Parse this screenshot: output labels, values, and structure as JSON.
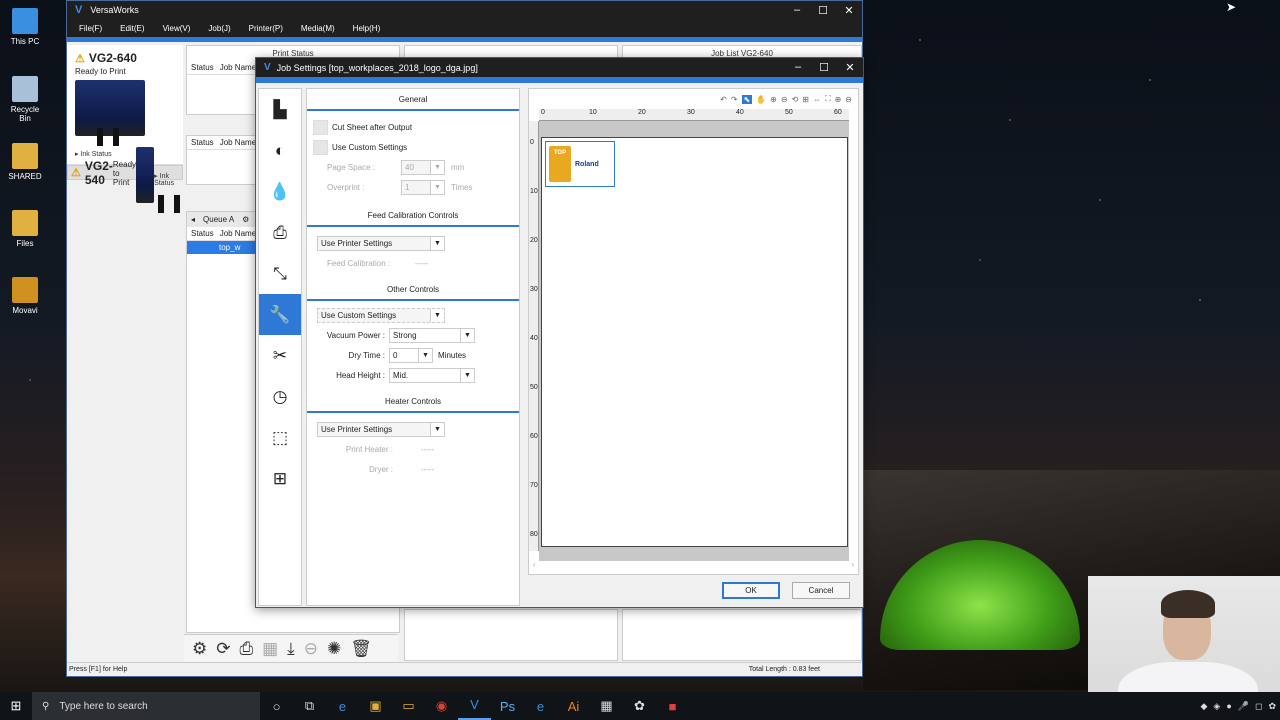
{
  "desktop": {
    "icons": [
      {
        "label": "This PC",
        "color": "#3a8fe0"
      },
      {
        "label": "Recycle Bin",
        "color": "#a8c0d8"
      },
      {
        "label": "SHARED",
        "color": "#e0b040"
      },
      {
        "label": "Files",
        "color": "#e0b040"
      },
      {
        "label": "Movavi",
        "color": "#d09020"
      }
    ]
  },
  "app": {
    "title": "VersaWorks",
    "menu": [
      "File(F)",
      "Edit(E)",
      "View(V)",
      "Job(J)",
      "Printer(P)",
      "Media(M)",
      "Help(H)"
    ],
    "printers": [
      {
        "name": "VG2-640",
        "status": "Ready to Print",
        "ink": "Ink Status"
      },
      {
        "name": "VG2-540",
        "status": "Ready to Print",
        "ink": "Ink Status"
      }
    ],
    "print_status": "Print Status",
    "job_list": "Job List VG2-640",
    "col_status": "Status",
    "col_jobname": "Job Name",
    "queue": "Queue A",
    "selected_job": "top_w",
    "status_left": "Press [F1] for Help",
    "status_right": "Total Length : 0.83 feet"
  },
  "dialog": {
    "title": "Job Settings [top_workplaces_2018_logo_dga.jpg]",
    "general": {
      "header": "General",
      "cut_sheet": "Cut Sheet after Output",
      "custom": "Use Custom Settings",
      "page_space_label": "Page Space :",
      "page_space_value": "40",
      "page_space_unit": "mm",
      "overprint_label": "Overprint :",
      "overprint_value": "1",
      "overprint_unit": "Times"
    },
    "feed": {
      "header": "Feed Calibration Controls",
      "select": "Use Printer Settings",
      "label": "Feed Calibration :",
      "value": "-----"
    },
    "other": {
      "header": "Other Controls",
      "select": "Use Custom Settings",
      "vacuum_label": "Vacuum Power :",
      "vacuum_value": "Strong",
      "dry_label": "Dry Time :",
      "dry_value": "0",
      "dry_unit": "Minutes",
      "head_label": "Head Height :",
      "head_value": "Mid."
    },
    "heater": {
      "header": "Heater Controls",
      "select": "Use Printer Settings",
      "print_heater_label": "Print Heater :",
      "print_heater_value": "-----",
      "dryer_label": "Dryer :",
      "dryer_value": "-----"
    },
    "ruler_h": [
      "0",
      "10",
      "20",
      "30",
      "40",
      "50",
      "60"
    ],
    "ruler_v": [
      "0",
      "10",
      "20",
      "30",
      "40",
      "50",
      "60",
      "70",
      "80"
    ],
    "logo_badge": "TOP",
    "logo_brand": "Roland",
    "ok": "OK",
    "cancel": "Cancel"
  },
  "taskbar": {
    "search": "Type here to search"
  }
}
